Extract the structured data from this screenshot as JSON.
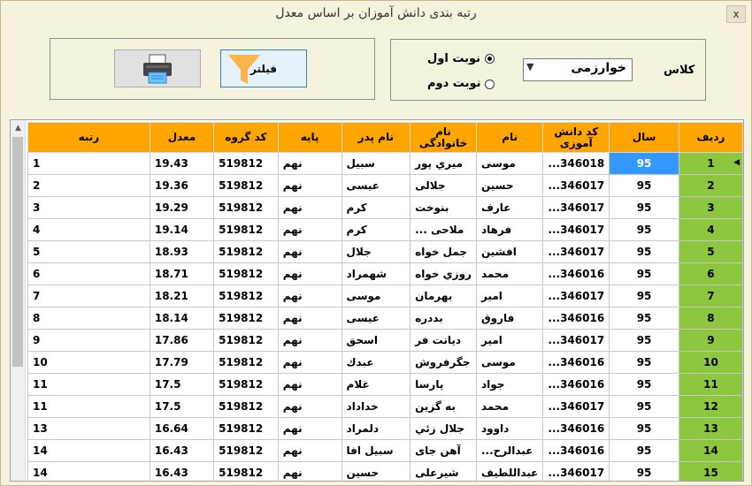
{
  "window": {
    "title": "رتبه بندی دانش آموزان بر اساس معدل",
    "close_label": "x"
  },
  "controls": {
    "class_label": "کلاس",
    "class_value": "خوارزمی",
    "shift1_label": "نوبت اول",
    "shift2_label": "نوبت دوم",
    "selected_shift": "shift1",
    "filter_label": "فیلتر"
  },
  "grid": {
    "columns": [
      "ردیف",
      "سال",
      "کد دانش آموزی",
      "نام",
      "نام خانوادگی",
      "نام پدر",
      "پایه",
      "کد گروه",
      "معدل",
      "رتبه"
    ],
    "rows": [
      [
        "1",
        "95",
        "346018...",
        "موسی",
        "میري پور",
        "سبیل",
        "نهم",
        "519812",
        "19.43",
        "1"
      ],
      [
        "2",
        "95",
        "346017...",
        "حسین",
        "جلالی",
        "عیسی",
        "نهم",
        "519812",
        "19.36",
        "2"
      ],
      [
        "3",
        "95",
        "346017...",
        "عارف",
        "بنوخت",
        "کرم",
        "نهم",
        "519812",
        "19.29",
        "3"
      ],
      [
        "4",
        "95",
        "346017...",
        "فرهاد",
        "ملاحی ...",
        "کرم",
        "نهم",
        "519812",
        "19.14",
        "4"
      ],
      [
        "5",
        "95",
        "346017...",
        "افشین",
        "جمل خواه",
        "جلال",
        "نهم",
        "519812",
        "18.93",
        "5"
      ],
      [
        "6",
        "95",
        "346016...",
        "محمد",
        "روزي خواه",
        "شهمراد",
        "نهم",
        "519812",
        "18.71",
        "6"
      ],
      [
        "7",
        "95",
        "346017...",
        "امیر",
        "بهرمان",
        "موسی",
        "نهم",
        "519812",
        "18.21",
        "7"
      ],
      [
        "8",
        "95",
        "346016...",
        "فاروق",
        "بددره",
        "عیسی",
        "نهم",
        "519812",
        "18.14",
        "8"
      ],
      [
        "9",
        "95",
        "346017...",
        "امیر",
        "دیانت فر",
        "اسحق",
        "نهم",
        "519812",
        "17.86",
        "9"
      ],
      [
        "10",
        "95",
        "346016...",
        "موسی",
        "جگرفروش",
        "عبدك",
        "نهم",
        "519812",
        "17.79",
        "10"
      ],
      [
        "11",
        "95",
        "346016...",
        "جواد",
        "پارسا",
        "غلام",
        "نهم",
        "519812",
        "17.5",
        "11"
      ],
      [
        "12",
        "95",
        "346017...",
        "محمد",
        "به گزین",
        "خداداد",
        "نهم",
        "519812",
        "17.5",
        "11"
      ],
      [
        "13",
        "95",
        "346016...",
        "داوود",
        "جلال زئي",
        "دلمراد",
        "نهم",
        "519812",
        "16.64",
        "13"
      ],
      [
        "14",
        "95",
        "346016...",
        "عبدالرح...",
        "آهن جای",
        "سبیل افا",
        "نهم",
        "519812",
        "16.43",
        "14"
      ],
      [
        "15",
        "95",
        "346017...",
        "عبداللطیف",
        "شیرعلی",
        "حسین",
        "نهم",
        "519812",
        "16.43",
        "14"
      ]
    ],
    "selected_row": 1
  }
}
